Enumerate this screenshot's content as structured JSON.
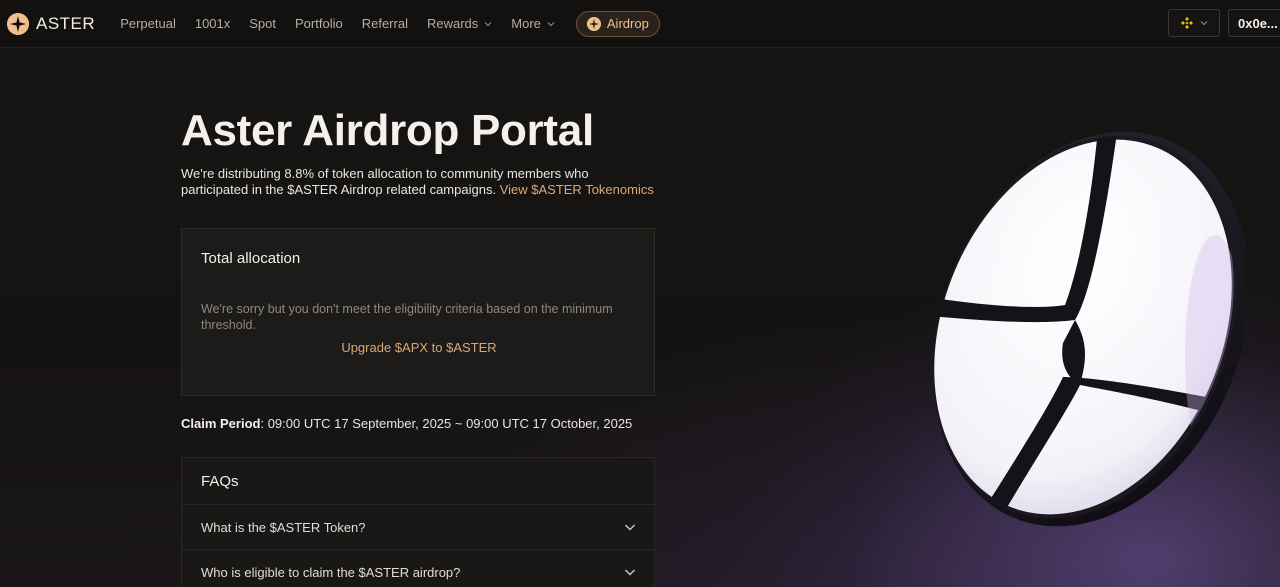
{
  "nav": {
    "brand": "ASTER",
    "items": [
      {
        "label": "Perpetual",
        "dropdown": false
      },
      {
        "label": "1001x",
        "dropdown": false
      },
      {
        "label": "Spot",
        "dropdown": false
      },
      {
        "label": "Portfolio",
        "dropdown": false
      },
      {
        "label": "Referral",
        "dropdown": false
      },
      {
        "label": "Rewards",
        "dropdown": true
      },
      {
        "label": "More",
        "dropdown": true
      }
    ],
    "airdrop_label": "Airdrop",
    "wallet_label": "0x0e..."
  },
  "hero": {
    "title": "Aster Airdrop Portal",
    "subtitle": "We're distributing 8.8% of token allocation to community members who participated in the $ASTER Airdrop related campaigns.",
    "subtitle_link": "View $ASTER Tokenomics"
  },
  "allocation": {
    "title": "Total allocation",
    "message": "We're sorry but you don't meet the eligibility criteria based on the minimum threshold.",
    "upgrade_link": "Upgrade $APX to $ASTER"
  },
  "claim": {
    "label": "Claim Period",
    "value": ": 09:00 UTC 17 September, 2025 ~ 09:00 UTC 17 October, 2025"
  },
  "faq": {
    "title": "FAQs",
    "items": [
      "What is the $ASTER Token?",
      "Who is eligible to claim the $ASTER airdrop?"
    ]
  },
  "colors": {
    "accent": "#efbf8f",
    "link": "#d9a878",
    "background": "#141211"
  },
  "icons": {
    "logo": "aster-logo-icon",
    "airdrop": "aster-star-icon",
    "chain": "bnb-chain-icon",
    "chevron": "chevron-down-icon"
  }
}
